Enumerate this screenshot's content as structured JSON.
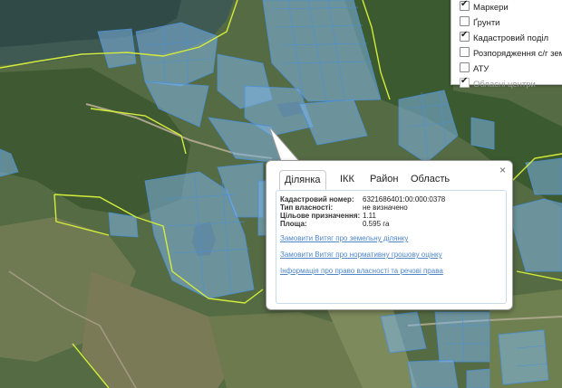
{
  "layers_panel": {
    "items": [
      {
        "label": "Маркери",
        "checked": true,
        "disabled": false
      },
      {
        "label": "Ґрунти",
        "checked": false,
        "disabled": false
      },
      {
        "label": "Кадастровий поділ",
        "checked": true,
        "disabled": false
      },
      {
        "label": "Розпорядження с/г землями",
        "checked": false,
        "disabled": false
      },
      {
        "label": "АТУ",
        "checked": false,
        "disabled": false
      },
      {
        "label": "Обласні центри",
        "checked": true,
        "disabled": true
      }
    ]
  },
  "popup": {
    "close_icon": "×",
    "tabs": [
      "Ділянка",
      "ІКК",
      "Район",
      "Область"
    ],
    "active_tab": "Ділянка",
    "info": [
      {
        "label": "Кадастровий номер:",
        "value": "6321686401:00:000:0378"
      },
      {
        "label": "Тип власності:",
        "value": "не визначено"
      },
      {
        "label": "Цільове призначення:",
        "value": "1.11"
      },
      {
        "label": "Площа:",
        "value": "0.595 га"
      }
    ],
    "links": [
      "Замовити Витяг про земельну ділянку",
      "Замовити Витяг про нормативну грошову оцінку",
      "Інформація про право власності та речові права"
    ]
  },
  "colors": {
    "parcel_fill": "#7fb4e3",
    "parcel_stroke": "#4a90d9",
    "boundary_line": "#d4ec3a",
    "link": "#4f86c8"
  }
}
